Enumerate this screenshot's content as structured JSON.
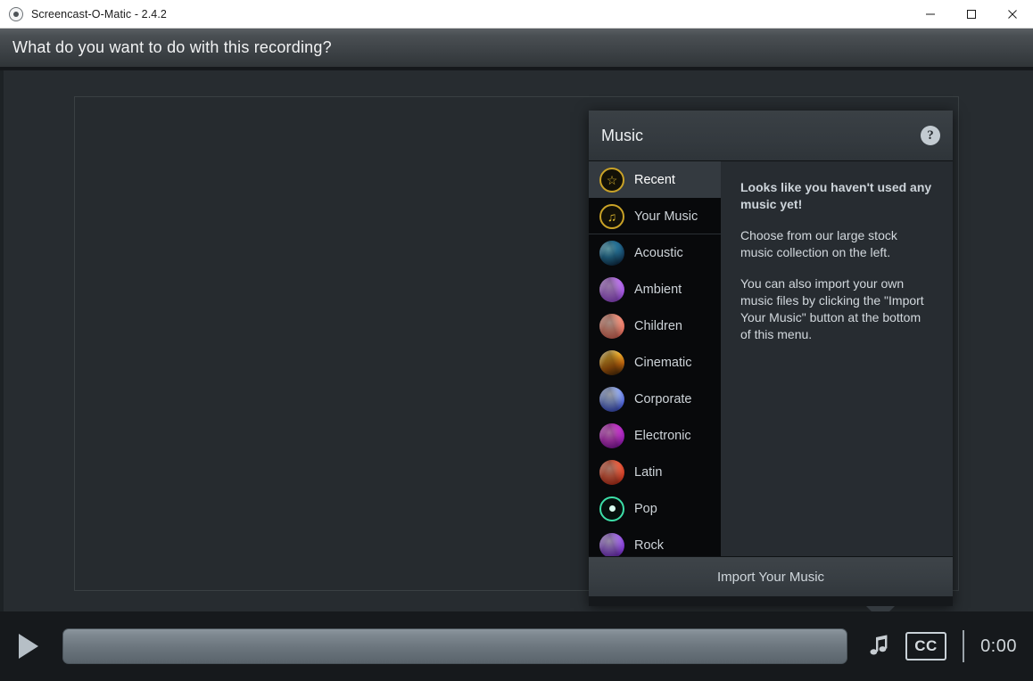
{
  "window": {
    "title": "Screencast-O-Matic - 2.4.2",
    "app_icon": "record-dot-icon",
    "controls": {
      "minimize": "minimize-icon",
      "maximize": "maximize-icon",
      "close": "close-icon"
    }
  },
  "header": {
    "question": "What do you want to do with this recording?"
  },
  "popup": {
    "title": "Music",
    "help_icon": "?",
    "categories": [
      {
        "label": "Recent",
        "icon": "star-ring-icon",
        "glyph": "☆",
        "selected": true,
        "separator_below": false
      },
      {
        "label": "Your Music",
        "icon": "note-ring-icon",
        "glyph": "♫",
        "selected": false,
        "separator_below": true
      },
      {
        "label": "Acoustic",
        "icon": "acoustic-thumb-icon",
        "glyph": "",
        "selected": false,
        "separator_below": false
      },
      {
        "label": "Ambient",
        "icon": "ambient-thumb-icon",
        "glyph": "",
        "selected": false,
        "separator_below": false
      },
      {
        "label": "Children",
        "icon": "children-thumb-icon",
        "glyph": "",
        "selected": false,
        "separator_below": false
      },
      {
        "label": "Cinematic",
        "icon": "cinematic-thumb-icon",
        "glyph": "",
        "selected": false,
        "separator_below": false
      },
      {
        "label": "Corporate",
        "icon": "corporate-thumb-icon",
        "glyph": "",
        "selected": false,
        "separator_below": false
      },
      {
        "label": "Electronic",
        "icon": "electronic-thumb-icon",
        "glyph": "",
        "selected": false,
        "separator_below": false
      },
      {
        "label": "Latin",
        "icon": "latin-thumb-icon",
        "glyph": "",
        "selected": false,
        "separator_below": false
      },
      {
        "label": "Pop",
        "icon": "pop-thumb-icon",
        "glyph": "",
        "selected": false,
        "separator_below": false
      },
      {
        "label": "Rock",
        "icon": "rock-thumb-icon",
        "glyph": "",
        "selected": false,
        "separator_below": false
      }
    ],
    "empty_state": {
      "heading": "Looks like you haven't used any music yet!",
      "paragraph_1": "Choose from our large stock music collection on the left.",
      "paragraph_2": "You can also import your own music files by clicking the \"Import Your Music\" button at the bottom of this menu."
    },
    "import_button": "Import Your Music"
  },
  "bottom_bar": {
    "play_icon": "play-icon",
    "music_icon": "music-note-icon",
    "cc_label": "CC",
    "time": "0:00"
  },
  "colors": {
    "window_chrome": "#ffffff",
    "header_bar": "#3c4145",
    "stage_background": "#272c30",
    "popup_background": "#15181b",
    "popup_list_background": "#08090b",
    "popup_content_background": "#272c31",
    "selected_item": "#343a40",
    "accent_gold": "#c9a227",
    "scrubber": "#6b757d",
    "text_primary": "#eceff1",
    "text_secondary": "#cdd3d8"
  }
}
